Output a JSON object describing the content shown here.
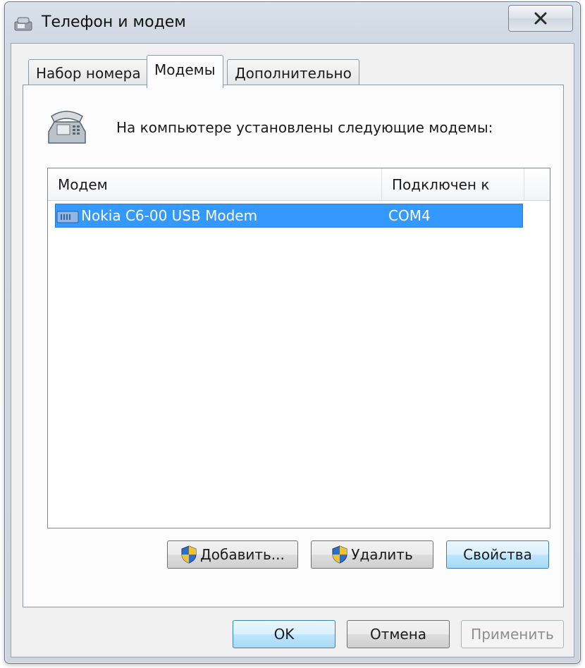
{
  "window": {
    "title": "Телефон и модем"
  },
  "tabs": [
    {
      "label": "Набор номера",
      "active": false
    },
    {
      "label": "Модемы",
      "active": true
    },
    {
      "label": "Дополнительно",
      "active": false
    }
  ],
  "modems_panel": {
    "intro": "На компьютере установлены следующие модемы:",
    "columns": [
      "Модем",
      "Подключен к"
    ],
    "rows": [
      {
        "modem": "Nokia C6-00 USB Modem",
        "port": "COM4",
        "selected": true
      }
    ],
    "buttons": {
      "add": "Добавить...",
      "remove": "Удалить",
      "properties": "Свойства"
    }
  },
  "dialog_buttons": {
    "ok": "OK",
    "cancel": "Отмена",
    "apply": "Применить"
  },
  "colors": {
    "selection": "#3399ff",
    "default_button": "#bee6fd",
    "disabled_text": "#8d8d8d"
  },
  "icons": {
    "title": "phone-modem-icon",
    "intro": "telephone-icon",
    "row": "modem-icon",
    "uac": "uac-shield-icon"
  }
}
